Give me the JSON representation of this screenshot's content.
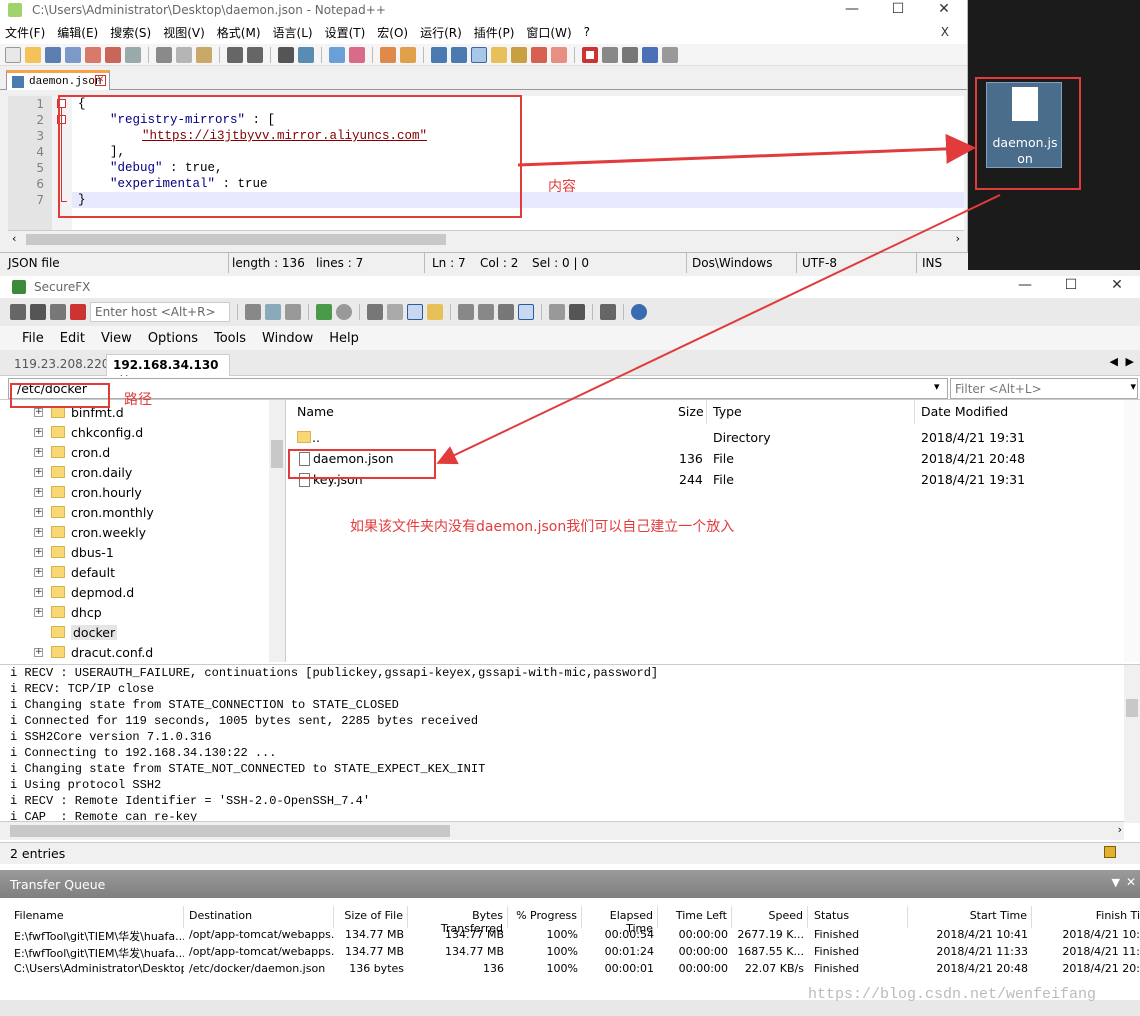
{
  "notepad": {
    "title": "C:\\Users\\Administrator\\Desktop\\daemon.json - Notepad++",
    "menu": [
      "文件(F)",
      "编辑(E)",
      "搜索(S)",
      "视图(V)",
      "格式(M)",
      "语言(L)",
      "设置(T)",
      "宏(O)",
      "运行(R)",
      "插件(P)",
      "窗口(W)",
      "?"
    ],
    "close_x": "X",
    "tab": "daemon.json",
    "lines": [
      "1",
      "2",
      "3",
      "4",
      "5",
      "6",
      "7"
    ],
    "code": {
      "l1": "{",
      "l2k": "\"registry-mirrors\"",
      "l2r": " : [",
      "l3": "\"https://i3jtbyvv.mirror.aliyuncs.com\"",
      "l4": "],",
      "l5k": "\"debug\"",
      "l5r": " : true,",
      "l6k": "\"experimental\"",
      "l6r": " : true",
      "l7": "}"
    },
    "status": {
      "type": "JSON file",
      "length": "length : 136",
      "lines": "lines : 7",
      "ln": "Ln : 7",
      "col": "Col : 2",
      "sel": "Sel : 0 | 0",
      "eol": "Dos\\Windows",
      "enc": "UTF-8",
      "ins": "INS"
    }
  },
  "desktop": {
    "icon_label": "daemon.json"
  },
  "annotations": {
    "content": "内容",
    "path": "路径",
    "hint": "如果该文件夹内没有daemon.json我们可以自己建立一个放入"
  },
  "securefx": {
    "title": "SecureFX",
    "host_placeholder": "Enter host <Alt+R>",
    "menu": [
      "File",
      "Edit",
      "View",
      "Options",
      "Tools",
      "Window",
      "Help"
    ],
    "tabs": [
      "119.23.208.220",
      "192.168.34.130"
    ],
    "path": "/etc/docker",
    "filter_placeholder": "Filter <Alt+L>",
    "tree": [
      "binfmt.d",
      "chkconfig.d",
      "cron.d",
      "cron.daily",
      "cron.hourly",
      "cron.monthly",
      "cron.weekly",
      "dbus-1",
      "default",
      "depmod.d",
      "dhcp",
      "docker",
      "dracut.conf.d"
    ],
    "file_headers": {
      "name": "Name",
      "size": "Size",
      "type": "Type",
      "date": "Date Modified"
    },
    "files": [
      {
        "name": "..",
        "size": "",
        "type": "Directory",
        "date": "2018/4/21 19:31"
      },
      {
        "name": "daemon.json",
        "size": "136",
        "type": "File",
        "date": "2018/4/21 20:48"
      },
      {
        "name": "key.json",
        "size": "244",
        "type": "File",
        "date": "2018/4/21 19:31"
      }
    ],
    "log": [
      "i RECV : USERAUTH_FAILURE, continuations [publickey,gssapi-keyex,gssapi-with-mic,password]",
      "i RECV: TCP/IP close",
      "i Changing state from STATE_CONNECTION to STATE_CLOSED",
      "i Connected for 119 seconds, 1005 bytes sent, 2285 bytes received",
      "i SSH2Core version 7.1.0.316",
      "i Connecting to 192.168.34.130:22 ...",
      "i Changing state from STATE_NOT_CONNECTED to STATE_EXPECT_KEX_INIT",
      "i Using protocol SSH2",
      "i RECV : Remote Identifier = 'SSH-2.0-OpenSSH_7.4'",
      "i CAP  : Remote can re-key"
    ],
    "entries": "2 entries",
    "queue_title": "Transfer Queue",
    "queue_headers": [
      "Filename",
      "Destination",
      "Size of File",
      "Bytes Transferred",
      "% Progress",
      "Elapsed Time",
      "Time Left",
      "Speed",
      "Status",
      "Start Time",
      "Finish Ti"
    ],
    "queue_rows": [
      [
        "E:\\fwfTool\\git\\TIEM\\华发\\huafa...",
        "/opt/app-tomcat/webapps...",
        "134.77 MB",
        "134.77 MB",
        "100%",
        "00:00:54",
        "00:00:00",
        "2677.19 K...",
        "Finished",
        "2018/4/21 10:41",
        "2018/4/21 10:"
      ],
      [
        "E:\\fwfTool\\git\\TIEM\\华发\\huafa...",
        "/opt/app-tomcat/webapps...",
        "134.77 MB",
        "134.77 MB",
        "100%",
        "00:01:24",
        "00:00:00",
        "1687.55 K...",
        "Finished",
        "2018/4/21 11:33",
        "2018/4/21 11:"
      ],
      [
        "C:\\Users\\Administrator\\Desktop...",
        "/etc/docker/daemon.json",
        "136 bytes",
        "136",
        "100%",
        "00:00:01",
        "00:00:00",
        "22.07 KB/s",
        "Finished",
        "2018/4/21 20:48",
        "2018/4/21 20:"
      ]
    ]
  },
  "watermark": "https://blog.csdn.net/wenfeifang"
}
